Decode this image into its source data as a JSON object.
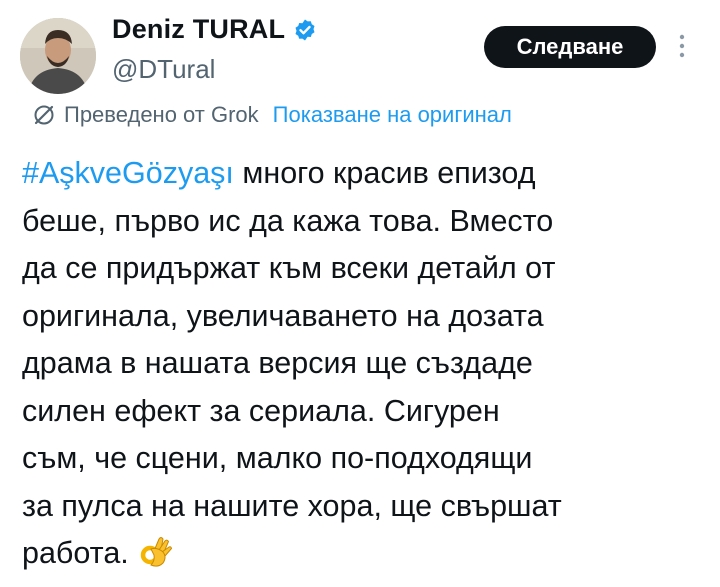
{
  "author": {
    "display_name": "Deniz TURAL",
    "handle": "@DTural",
    "verified": true,
    "avatar_icon": "profile-photo"
  },
  "header": {
    "follow_label": "Следване",
    "more_icon": "more-vertical-icon"
  },
  "translation": {
    "icon": "translate-icon",
    "label": "Преведено от Grok",
    "show_original_label": "Показване на оригинал"
  },
  "tweet": {
    "hashtag": "#AşkveGözyaşı",
    "lines": [
      " много красив епизод",
      "беше, първо ис да кажа това. Вместо",
      "да се придържат към всеки детайл от",
      "оригинала, увеличаването на дозата",
      "драма в нашата версия ще създаде",
      "силен ефект за сериала. Сигурен",
      "съм, че сцени, малко по-подходящи",
      "за пулса на нашите хора, ще свършат",
      "работа."
    ],
    "emoji": "ok-hand-emoji"
  },
  "colors": {
    "link": "#1d9bf0",
    "text": "#0f1419",
    "secondary_text": "#536471",
    "button_bg": "#0f1419",
    "verified_badge": "#1d9bf0"
  }
}
